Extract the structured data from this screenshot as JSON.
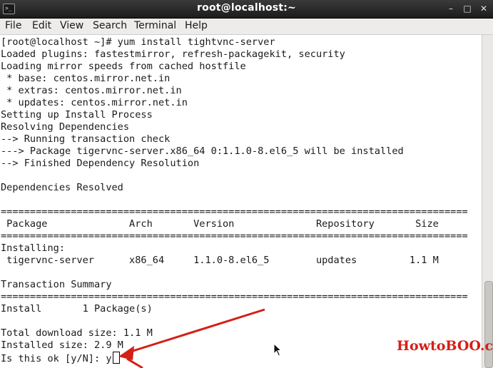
{
  "window": {
    "title": "root@localhost:~",
    "app_icon_text": ">_",
    "minimize_glyph": "–",
    "maximize_glyph": "□",
    "close_glyph": "✕"
  },
  "menubar": {
    "items": [
      "File",
      "Edit",
      "View",
      "Search",
      "Terminal",
      "Help"
    ]
  },
  "terminal": {
    "lines": [
      "[root@localhost ~]# yum install tightvnc-server",
      "Loaded plugins: fastestmirror, refresh-packagekit, security",
      "Loading mirror speeds from cached hostfile",
      " * base: centos.mirror.net.in",
      " * extras: centos.mirror.net.in",
      " * updates: centos.mirror.net.in",
      "Setting up Install Process",
      "Resolving Dependencies",
      "--> Running transaction check",
      "---> Package tigervnc-server.x86_64 0:1.1.0-8.el6_5 will be installed",
      "--> Finished Dependency Resolution",
      "",
      "Dependencies Resolved",
      "",
      "================================================================================",
      " Package              Arch       Version              Repository       Size",
      "================================================================================",
      "Installing:",
      " tigervnc-server      x86_64     1.1.0-8.el6_5        updates         1.1 M",
      "",
      "Transaction Summary",
      "================================================================================",
      "Install       1 Package(s)",
      "",
      "Total download size: 1.1 M",
      "Installed size: 2.9 M"
    ],
    "prompt_text": "Is this ok [y/N]: y"
  },
  "watermark": "HowtoBOO.com",
  "colors": {
    "annotation_arrow": "#d42016",
    "terminal_bg": "#ffffff",
    "terminal_fg": "#1a1a1a",
    "titlebar_bg": "#2a2a2a"
  }
}
